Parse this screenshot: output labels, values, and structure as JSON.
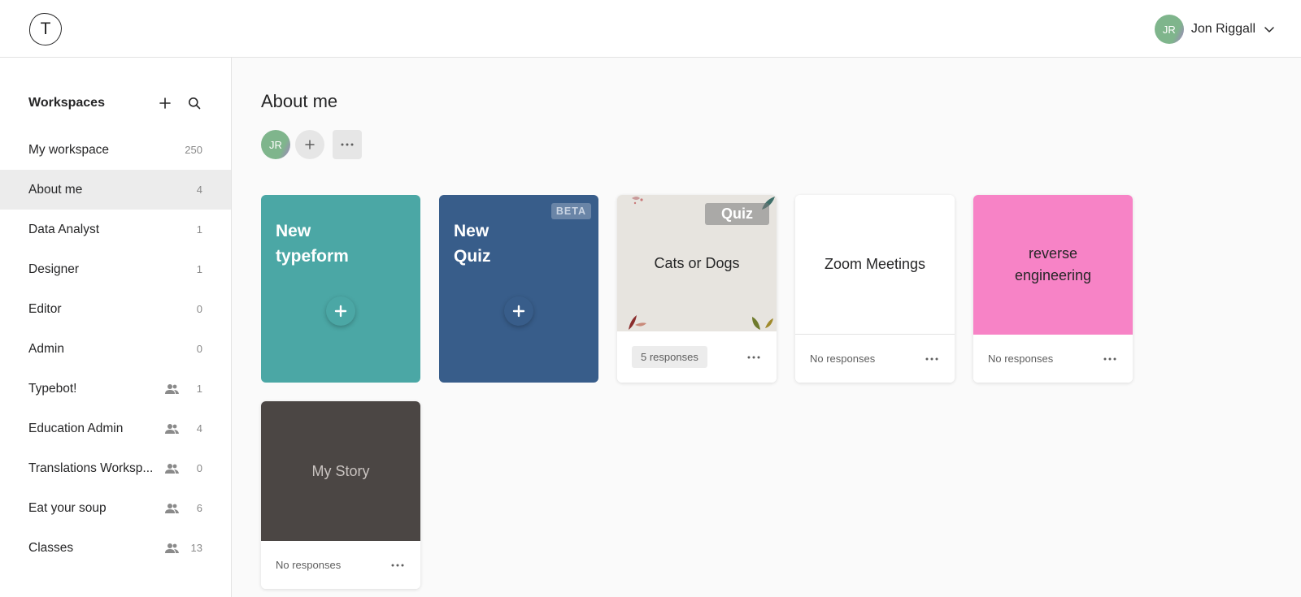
{
  "header": {
    "logo_letter": "T",
    "user_initials": "JR",
    "user_name": "Jon Riggall"
  },
  "sidebar": {
    "title": "Workspaces",
    "items": [
      {
        "label": "My workspace",
        "count": "250",
        "shared": false,
        "active": false
      },
      {
        "label": "About me",
        "count": "4",
        "shared": false,
        "active": true
      },
      {
        "label": "Data Analyst",
        "count": "1",
        "shared": false,
        "active": false
      },
      {
        "label": "Designer",
        "count": "1",
        "shared": false,
        "active": false
      },
      {
        "label": "Editor",
        "count": "0",
        "shared": false,
        "active": false
      },
      {
        "label": "Admin",
        "count": "0",
        "shared": false,
        "active": false
      },
      {
        "label": "Typebot!",
        "count": "1",
        "shared": true,
        "active": false
      },
      {
        "label": "Education Admin",
        "count": "4",
        "shared": true,
        "active": false
      },
      {
        "label": "Translations Worksp...",
        "count": "0",
        "shared": true,
        "active": false
      },
      {
        "label": "Eat your soup",
        "count": "6",
        "shared": true,
        "active": false
      },
      {
        "label": "Classes",
        "count": "13",
        "shared": true,
        "active": false
      }
    ]
  },
  "main": {
    "title": "About me",
    "member_initials": "JR",
    "create_cards": [
      {
        "title_line1": "New",
        "title_line2": "typeform",
        "color": "#4ba7a5",
        "badge": ""
      },
      {
        "title_line1": "New",
        "title_line2": "Quiz",
        "color": "#385d8a",
        "badge": "BETA"
      }
    ],
    "forms": [
      {
        "title": "Cats or Dogs",
        "responses": "5 responses",
        "tag": "Quiz",
        "color": "#e7e4df"
      },
      {
        "title": "Zoom Meetings",
        "responses": "No responses",
        "tag": "",
        "color": "#ffffff"
      },
      {
        "title": "reverse engineering",
        "responses": "No responses",
        "tag": "",
        "color": "#f783c6"
      },
      {
        "title": "My Story",
        "responses": "No responses",
        "tag": "",
        "color": "#4b4644"
      }
    ]
  },
  "colors": {
    "accent_teal": "#4ba7a5",
    "accent_blue": "#385d8a",
    "pink": "#f783c6",
    "dark": "#4b4644"
  }
}
